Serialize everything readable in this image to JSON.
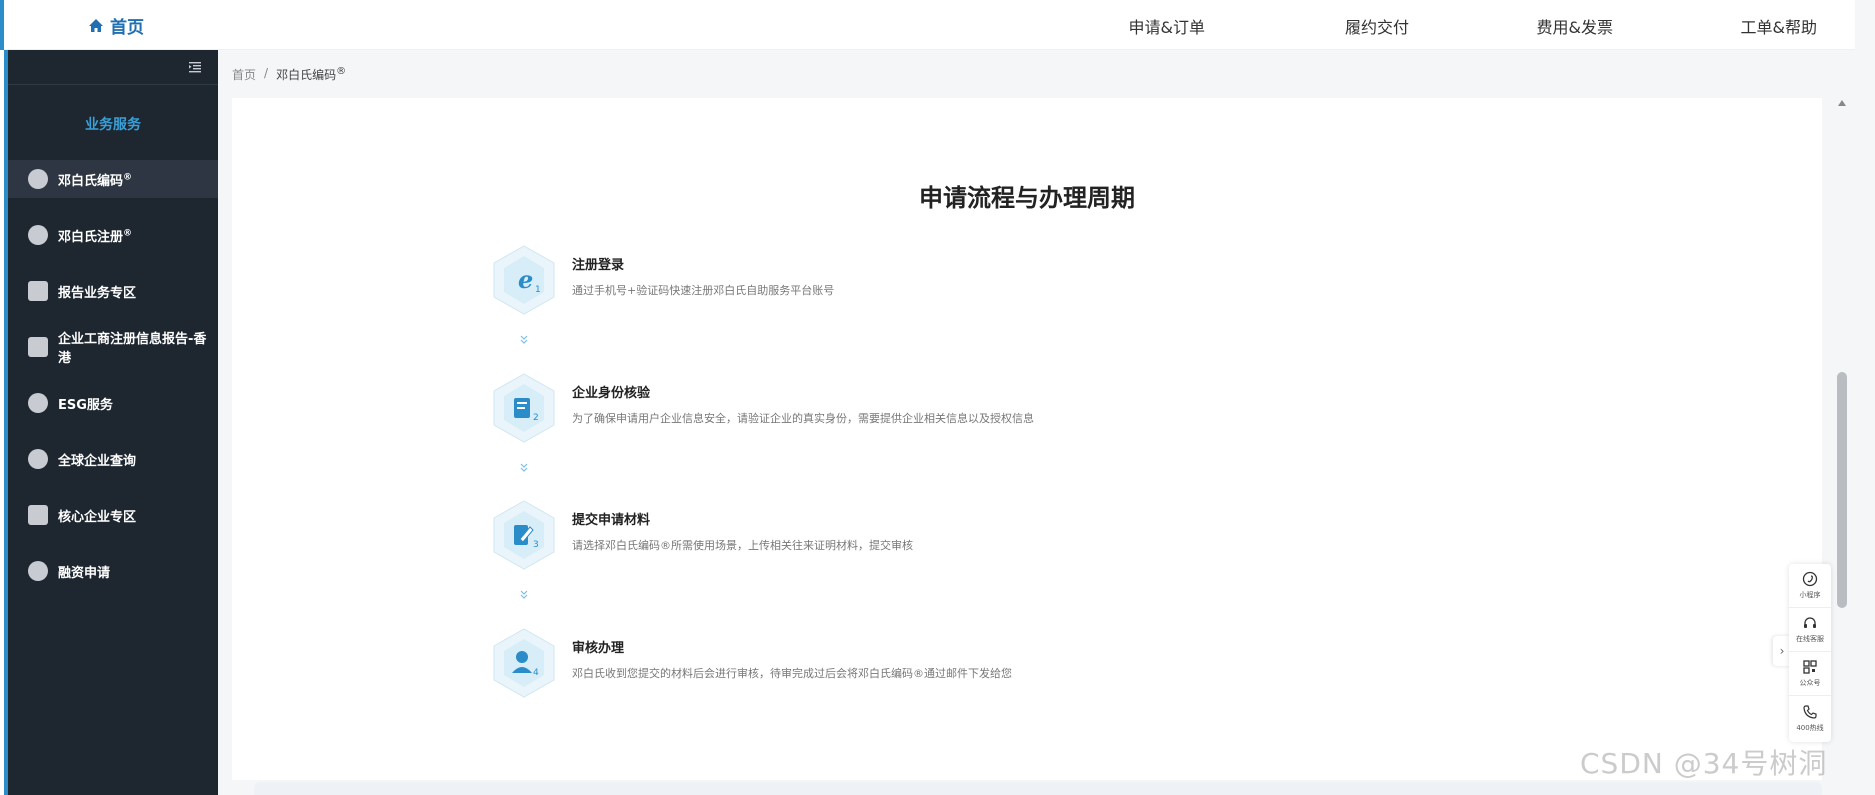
{
  "topbar": {
    "home_label": "首页",
    "nav": [
      "申请&订单",
      "履约交付",
      "费用&发票",
      "工单&帮助"
    ]
  },
  "sidebar": {
    "section_label": "业务服务",
    "items": [
      {
        "label": "邓白氏编码",
        "sup": "®",
        "icon": "globe-icon",
        "active": true
      },
      {
        "label": "邓白氏注册",
        "sup": "®",
        "icon": "user-icon",
        "active": false
      },
      {
        "label": "报告业务专区",
        "sup": "",
        "icon": "document-icon",
        "active": false
      },
      {
        "label": "企业工商注册信息报告-香港",
        "sup": "",
        "icon": "book-icon",
        "active": false
      },
      {
        "label": "ESG服务",
        "sup": "",
        "icon": "leaf-icon",
        "active": false
      },
      {
        "label": "全球企业查询",
        "sup": "",
        "icon": "earth-icon",
        "active": false
      },
      {
        "label": "核心企业专区",
        "sup": "",
        "icon": "building-icon",
        "active": false
      },
      {
        "label": "融资申请",
        "sup": "",
        "icon": "cloud-icon",
        "active": false
      }
    ]
  },
  "breadcrumb": {
    "root": "首页",
    "separator": "/",
    "current": "邓白氏编码",
    "current_sup": "®"
  },
  "main": {
    "title": "申请流程与办理周期",
    "steps": [
      {
        "title": "注册登录",
        "desc": "通过手机号+验证码快速注册邓白氏自助服务平台账号",
        "icon": "register-icon",
        "num": "1"
      },
      {
        "title": "企业身份核验",
        "desc": "为了确保申请用户企业信息安全，请验证企业的真实身份，需要提供企业相关信息以及授权信息",
        "icon": "verify-icon",
        "num": "2"
      },
      {
        "title": "提交申请材料",
        "desc": "请选择邓白氏编码®所需使用场景，上传相关往来证明材料，提交审核",
        "icon": "submit-icon",
        "num": "3"
      },
      {
        "title": "审核办理",
        "desc": "邓白氏收到您提交的材料后会进行审核，待审完成过后会将邓白氏编码®通过邮件下发给您",
        "icon": "review-icon",
        "num": "4"
      }
    ]
  },
  "float_panel": {
    "items": [
      {
        "label": "小程序",
        "icon": "miniprogram-icon"
      },
      {
        "label": "在线客服",
        "icon": "headset-icon"
      },
      {
        "label": "公众号",
        "icon": "qrcode-icon"
      },
      {
        "label": "400热线",
        "icon": "phone-icon"
      }
    ]
  },
  "watermark": "CSDN @34号树洞",
  "colors": {
    "accent": "#2a8cc8",
    "sidebar_bg": "#1e2630",
    "section_label": "#3aa0d8"
  }
}
